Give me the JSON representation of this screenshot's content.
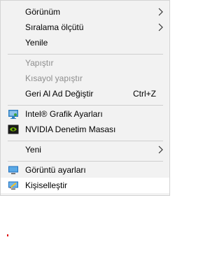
{
  "menu": {
    "items": [
      {
        "label": "Görünüm",
        "has_submenu": true
      },
      {
        "label": "Sıralama ölçütü",
        "has_submenu": true
      },
      {
        "label": "Yenile"
      },
      {
        "label": "Yapıştır",
        "disabled": true
      },
      {
        "label": "Kısayol yapıştır",
        "disabled": true
      },
      {
        "label": "Geri Al Ad Değiştir",
        "shortcut": "Ctrl+Z"
      },
      {
        "label": "Intel® Grafik Ayarları",
        "icon": "intel-graphics-icon"
      },
      {
        "label": "NVIDIA Denetim Masası",
        "icon": "nvidia-icon"
      },
      {
        "label": "Yeni",
        "has_submenu": true
      },
      {
        "label": "Görüntü ayarları",
        "icon": "display-settings-icon"
      },
      {
        "label": "Kişiselleştir",
        "icon": "personalize-icon"
      }
    ]
  },
  "colors": {
    "menu_background": "#f2f2f2",
    "highlight_background": "#ffffff",
    "disabled_text": "#8e8e8e",
    "separator": "#cfcfcf"
  }
}
